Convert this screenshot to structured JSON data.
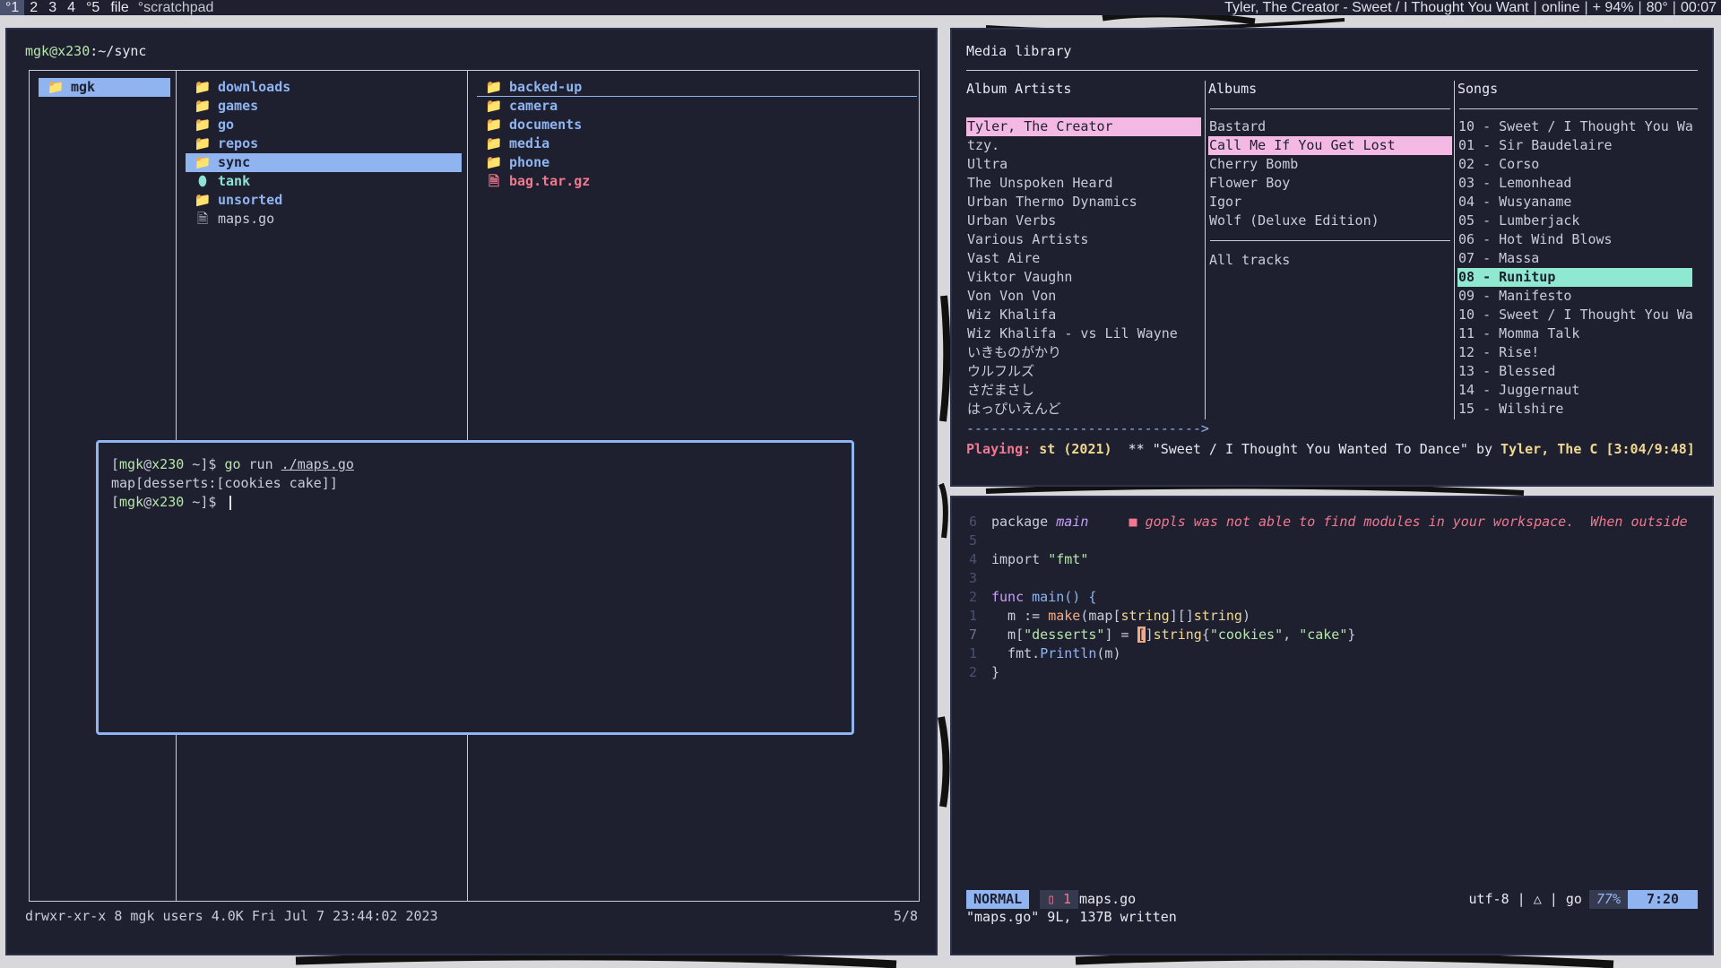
{
  "topbar": {
    "workspaces": [
      {
        "label": "°1",
        "active": true
      },
      {
        "label": "2",
        "active": false
      },
      {
        "label": "3",
        "active": false
      },
      {
        "label": "4",
        "active": false
      },
      {
        "label": "°5",
        "active": false
      }
    ],
    "layout": "file",
    "title": "°scratchpad",
    "now_playing": "Tyler, The Creator - Sweet / I Thought You Want",
    "network": "online",
    "battery": "+ 94%",
    "temperature": "80°",
    "clock": "00:07"
  },
  "file_manager": {
    "path_user": "mgk@x230",
    "path_dir": ":~/sync",
    "col1": [
      {
        "name": "mgk",
        "selected": true
      }
    ],
    "col2": [
      {
        "name": "downloads",
        "kind": "dir",
        "icon": "folder-icon"
      },
      {
        "name": "games",
        "kind": "dir",
        "icon": "folder-icon"
      },
      {
        "name": "go",
        "kind": "dir",
        "icon": "folder-icon"
      },
      {
        "name": "repos",
        "kind": "dir",
        "icon": "folder-icon"
      },
      {
        "name": "sync",
        "kind": "dir",
        "icon": "folder-icon",
        "selected": true
      },
      {
        "name": "tank",
        "kind": "mount",
        "icon": "drive-icon"
      },
      {
        "name": "unsorted",
        "kind": "dir",
        "icon": "folder-icon"
      },
      {
        "name": "maps.go",
        "kind": "file",
        "icon": "file-icon"
      }
    ],
    "col3": [
      {
        "name": "backed-up",
        "kind": "dir",
        "icon": "folder-icon"
      },
      {
        "name": "camera",
        "kind": "dir",
        "icon": "folder-icon"
      },
      {
        "name": "documents",
        "kind": "dir",
        "icon": "folder-icon"
      },
      {
        "name": "media",
        "kind": "dir",
        "icon": "folder-icon"
      },
      {
        "name": "phone",
        "kind": "dir",
        "icon": "folder-icon"
      },
      {
        "name": "bag.tar.gz",
        "kind": "archive",
        "icon": "file-icon"
      }
    ],
    "status": "drwxr-xr-x 8 mgk users 4.0K Fri Jul  7 23:44:02 2023",
    "count": "5/8"
  },
  "terminal": {
    "prompt_open": "[",
    "prompt_user": "mgk",
    "prompt_at": "@",
    "prompt_host": "x230",
    "prompt_rest": " ~]$ ",
    "cmd_go": "go",
    "cmd_run": " run ",
    "cmd_arg": "./maps.go",
    "output": "map[desserts:[cookies cake]]"
  },
  "media": {
    "title": "Media library",
    "headers": {
      "artists": "Album Artists",
      "albums": "Albums",
      "songs": "Songs"
    },
    "artists": [
      "Tyler, The Creator",
      "tzy.",
      "Ultra",
      "The Unspoken Heard",
      "Urban Thermo Dynamics",
      "Urban Verbs",
      "Various Artists",
      "Vast Aire",
      "Viktor Vaughn",
      "Von Von Von",
      "Wiz Khalifa",
      "Wiz Khalifa - vs Lil Wayne",
      "いきものがかり",
      "ウルフルズ",
      "さだまさし",
      "はっぴいえんど"
    ],
    "albums": [
      "Bastard",
      "Call Me If You Get Lost",
      "Cherry Bomb",
      "Flower Boy",
      "Igor",
      "Wolf (Deluxe Edition)"
    ],
    "all_tracks": "All tracks",
    "songs": [
      "10 - Sweet / I Thought You Wa",
      "01 - Sir Baudelaire",
      "02 - Corso",
      "03 - Lemonhead",
      "04 - Wusyaname",
      "05 - Lumberjack",
      "06 - Hot Wind Blows",
      "07 - Massa",
      "08 - Runitup",
      "09 - Manifesto",
      "10 - Sweet / I Thought You Wa",
      "11 - Momma Talk",
      "12 - Rise!",
      "13 - Blessed",
      "14 - Juggernaut",
      "15 - Wilshire"
    ],
    "selected_artist": 0,
    "selected_album": 1,
    "playing_song": 8,
    "progress": "----------------------------->",
    "playing_label": "Playing:",
    "playing_album": " st (2021)",
    "playing_mid": "  ** \"Sweet / I Thought You Wanted To Dance\" by ",
    "playing_artist": "Tyler, The C",
    "playing_time": " [3:04/9:48]"
  },
  "editor": {
    "line_numbers": [
      "6",
      "5",
      "4",
      "3",
      "2",
      "1",
      "7",
      "1",
      "2"
    ],
    "l_package": "package",
    "l_main": "main",
    "diagnostic": "■ gopls was not able to find modules in your workspace.  When outside",
    "l_import": "import",
    "l_fmt": "\"fmt\"",
    "l_func": "func",
    "l_mainfn": "main() {",
    "l2_m": "  m := ",
    "l2_make": "make",
    "l2_rest1": "(map[",
    "l2_string1": "string",
    "l2_rest2": "][]",
    "l2_string2": "string",
    "l2_rest3": ")",
    "l3_m": "  m[",
    "l3_desserts": "\"desserts\"",
    "l3_rest1": "] = ",
    "l3_br": "[",
    "l3_br2": "]",
    "l3_string": "string",
    "l3_rest2": "{",
    "l3_cookies": "\"cookies\"",
    "l3_comma": ", ",
    "l3_cake": "\"cake\"",
    "l3_rest3": "}",
    "l4_fmt": "  fmt.",
    "l4_println": "Println",
    "l4_rest": "(m)",
    "l5": "}",
    "mode": "NORMAL",
    "errors": "▯ 1",
    "filename": "maps.go",
    "encoding": "utf-8 | △ | go",
    "percent": "77%",
    "position": "7:20",
    "message": "\"maps.go\" 9L, 137B written"
  }
}
